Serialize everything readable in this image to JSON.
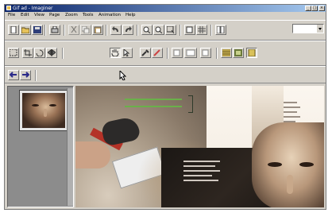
{
  "window": {
    "title": "Gif ad - Imaginer",
    "minimize_glyph": "_",
    "maximize_glyph": "□",
    "close_glyph": "×"
  },
  "menu": [
    "File",
    "Edit",
    "View",
    "Page",
    "Zoom",
    "Tools",
    "Animation",
    "Help"
  ],
  "toolbar1_icons": [
    "new-icon",
    "open-icon",
    "save-icon",
    "print-icon",
    "cut-icon",
    "copy-icon",
    "paste-icon",
    "undo-icon",
    "redo-icon",
    "zoom-in-icon",
    "zoom-out-icon",
    "zoom-fit-icon",
    "actual-size-icon",
    "grid-icon",
    "layout-icon"
  ],
  "toolbar2_icons": [
    "select-icon",
    "crop-icon",
    "rotate-icon",
    "flip-icon",
    "hand-icon",
    "arrow-icon",
    "eyedropper-icon",
    "pencil-icon",
    "frame-icon",
    "text-icon",
    "color-icon",
    "pattern-icon",
    "preview-icon"
  ],
  "toolbar3_icons": [
    "back-icon",
    "forward-icon"
  ],
  "colors": {
    "chrome": "#d4d0c8",
    "title_start": "#0a246a",
    "title_end": "#a6caf0"
  }
}
